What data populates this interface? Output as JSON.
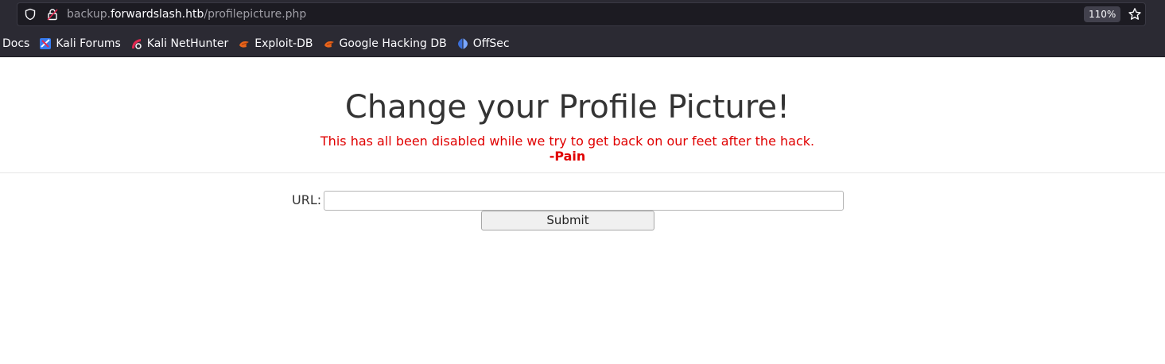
{
  "browser": {
    "url_prefix": "backup.",
    "url_domain": "forwardslash.htb",
    "url_path": "/profilepicture.php",
    "zoom": "110%"
  },
  "bookmarks": [
    {
      "label": "Docs",
      "icon": "none"
    },
    {
      "label": "Kali Forums",
      "icon": "kali-forums-icon"
    },
    {
      "label": "Kali NetHunter",
      "icon": "kali-nethunter-icon"
    },
    {
      "label": "Exploit-DB",
      "icon": "exploit-db-icon"
    },
    {
      "label": "Google Hacking DB",
      "icon": "ghdb-icon"
    },
    {
      "label": "OffSec",
      "icon": "offsec-icon"
    }
  ],
  "page": {
    "title": "Change your Profile Picture!",
    "notice": "This has all been disabled while we try to get back on our feet after the hack.",
    "signature": "-Pain",
    "url_label": "URL:",
    "url_value": "",
    "submit_label": "Submit"
  },
  "colors": {
    "chrome_bg": "#2b2a33",
    "notice_red": "#e00000",
    "title_gray": "#333333"
  }
}
